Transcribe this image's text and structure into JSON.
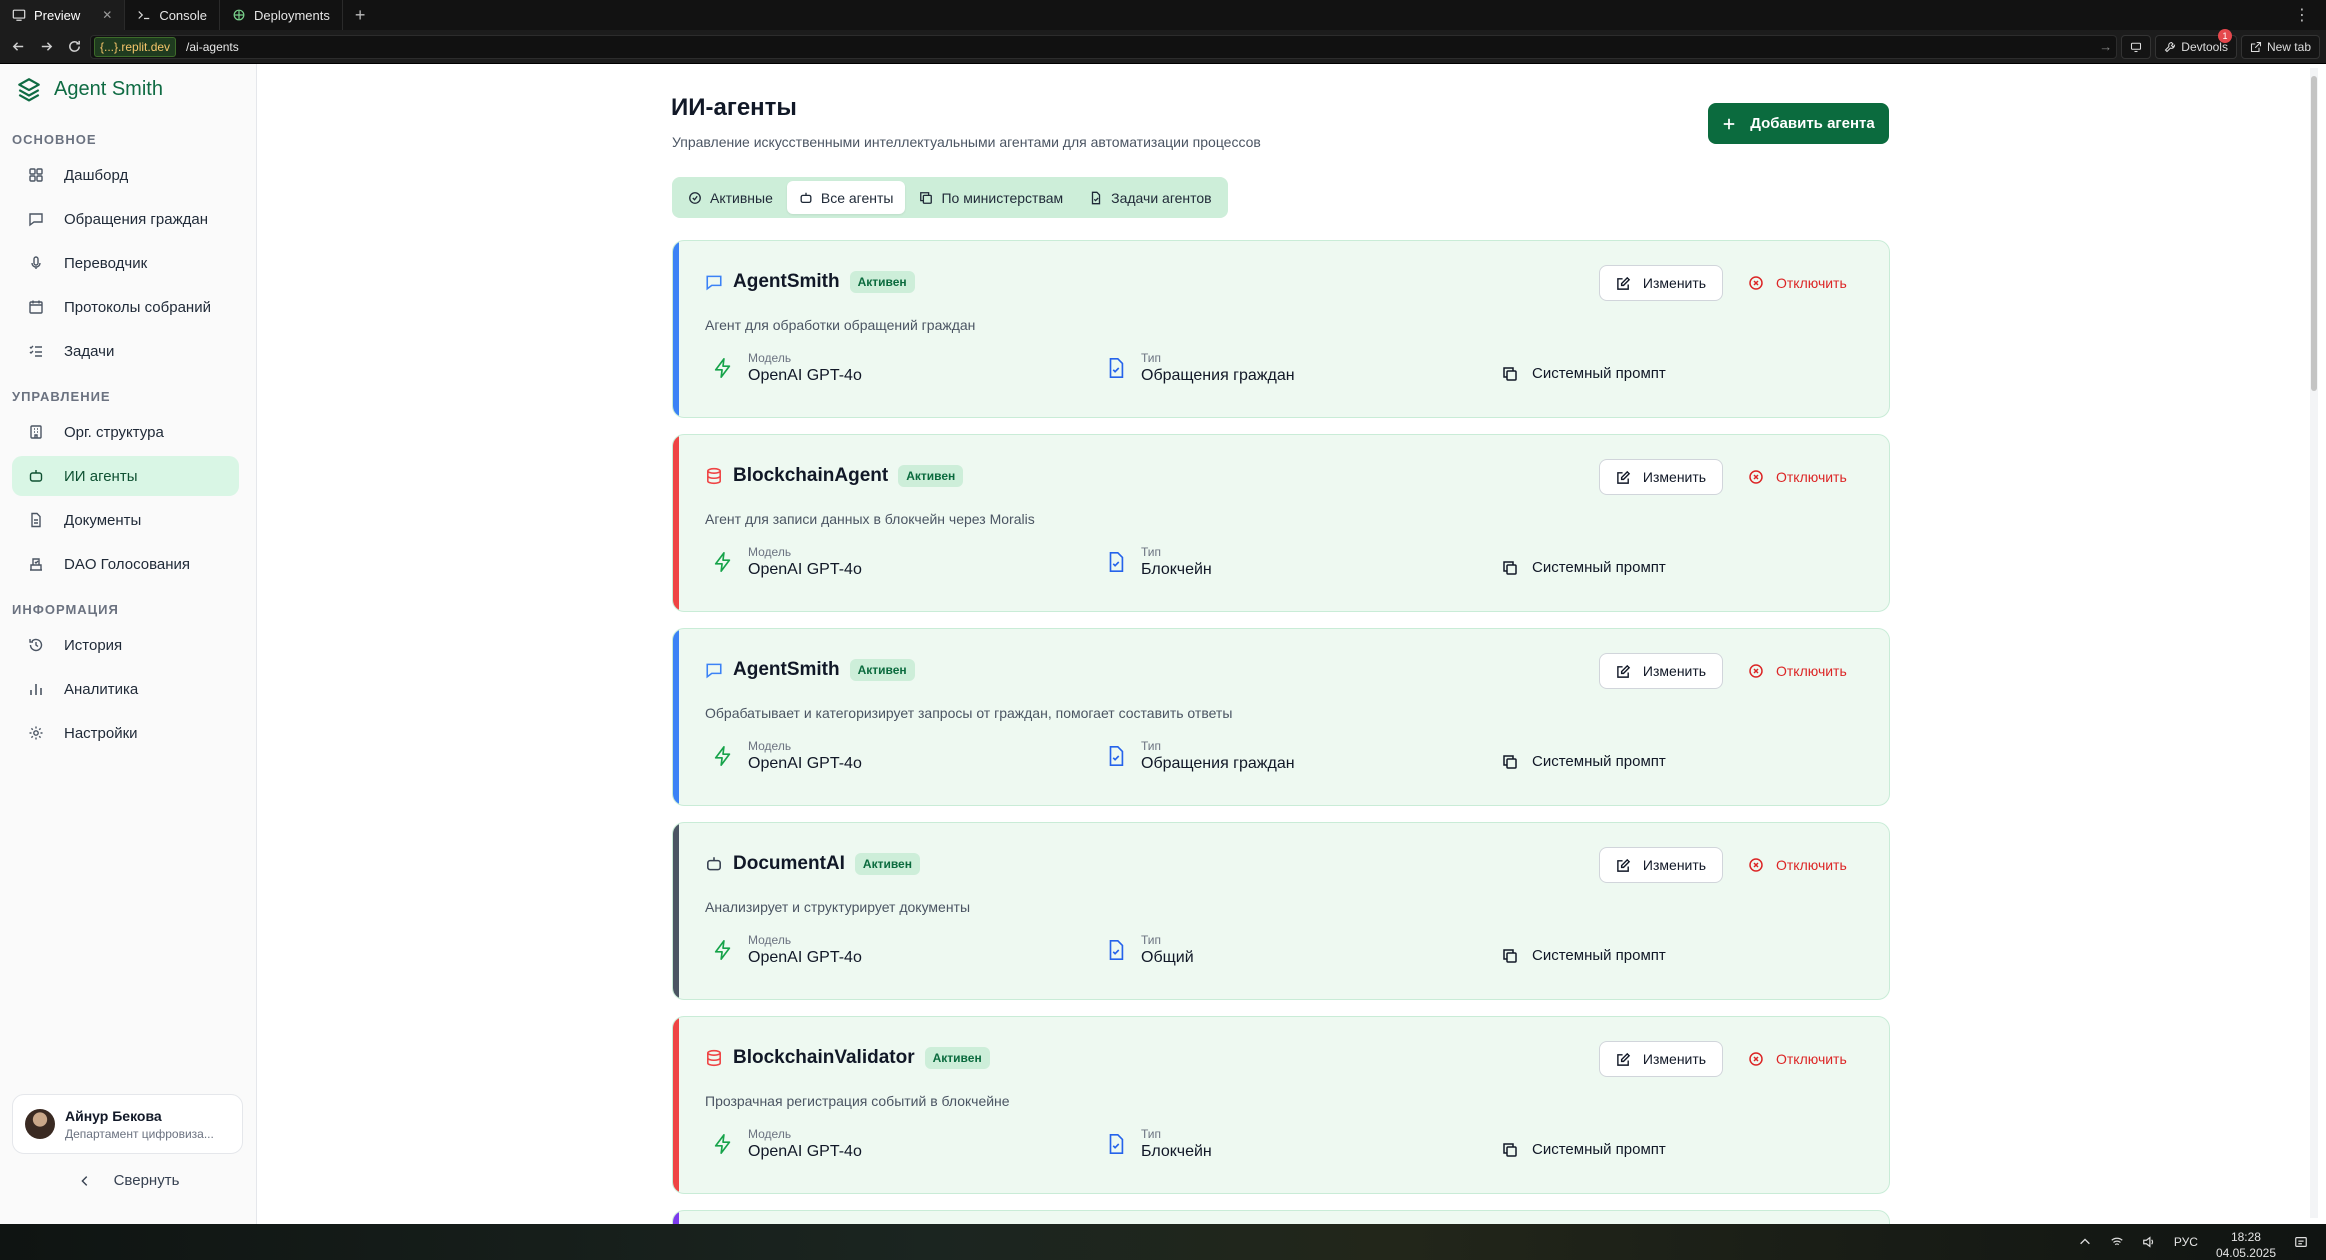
{
  "browser": {
    "tabs": [
      {
        "label": "Preview",
        "icon": "monitor-icon",
        "active": true
      },
      {
        "label": "Console",
        "icon": "terminal-icon"
      },
      {
        "label": "Deployments",
        "icon": "deploy-icon"
      }
    ],
    "url_domain": "{...}.replit.dev",
    "url_path": "/ai-agents",
    "devtools_label": "Devtools",
    "devtools_badge": "1",
    "newtab_label": "New tab"
  },
  "sidebar": {
    "brand": "Agent Smith",
    "sections": [
      {
        "title": "ОСНОВНОЕ",
        "items": [
          {
            "label": "Дашборд",
            "icon": "grid-icon"
          },
          {
            "label": "Обращения граждан",
            "icon": "message-icon"
          },
          {
            "label": "Переводчик",
            "icon": "mic-icon"
          },
          {
            "label": "Протоколы собраний",
            "icon": "calendar-icon"
          },
          {
            "label": "Задачи",
            "icon": "list-check-icon"
          }
        ]
      },
      {
        "title": "УПРАВЛЕНИЕ",
        "items": [
          {
            "label": "Орг. структура",
            "icon": "building-icon"
          },
          {
            "label": "ИИ агенты",
            "icon": "bot-icon",
            "active": true
          },
          {
            "label": "Документы",
            "icon": "document-icon"
          },
          {
            "label": "DAO Голосования",
            "icon": "vote-icon"
          }
        ]
      },
      {
        "title": "ИНФОРМАЦИЯ",
        "items": [
          {
            "label": "История",
            "icon": "history-icon"
          },
          {
            "label": "Аналитика",
            "icon": "bar-chart-icon"
          },
          {
            "label": "Настройки",
            "icon": "gear-icon"
          }
        ]
      }
    ],
    "user": {
      "name": "Айнур Бекова",
      "dept": "Департамент цифровиза..."
    },
    "collapse_label": "Свернуть"
  },
  "main": {
    "title": "ИИ-агенты",
    "subtitle": "Управление искусственными интеллектуальными агентами для автоматизации процессов",
    "add_button": "Добавить агента",
    "tabs": [
      {
        "label": "Активные",
        "icon": "check-circle-icon"
      },
      {
        "label": "Все агенты",
        "icon": "bot-icon",
        "active": true
      },
      {
        "label": "По министерствам",
        "icon": "copy-icon"
      },
      {
        "label": "Задачи агентов",
        "icon": "file-check-icon"
      }
    ],
    "model_label": "Модель",
    "type_label": "Тип",
    "prompt_label": "Системный промпт",
    "edit_label": "Изменить",
    "disable_label": "Отключить",
    "agents": [
      {
        "name": "AgentSmith",
        "status": "Активен",
        "description": "Агент для обработки обращений граждан",
        "model": "OpenAI GPT-4o",
        "type": "Обращения граждан",
        "accent": "#3b82f6",
        "icon": "chat-icon"
      },
      {
        "name": "BlockchainAgent",
        "status": "Активен",
        "description": "Агент для записи данных в блокчейн через Moralis",
        "model": "OpenAI GPT-4o",
        "type": "Блокчейн",
        "accent": "#ef4444",
        "icon": "database-icon"
      },
      {
        "name": "AgentSmith",
        "status": "Активен",
        "description": "Обрабатывает и категоризирует запросы от граждан, помогает составить ответы",
        "model": "OpenAI GPT-4o",
        "type": "Обращения граждан",
        "accent": "#3b82f6",
        "icon": "chat-icon"
      },
      {
        "name": "DocumentAI",
        "status": "Активен",
        "description": "Анализирует и структурирует документы",
        "model": "OpenAI GPT-4o",
        "type": "Общий",
        "accent": "#4b5563",
        "icon": "bot-icon"
      },
      {
        "name": "BlockchainValidator",
        "status": "Активен",
        "description": "Прозрачная регистрация событий в блокчейне",
        "model": "OpenAI GPT-4o",
        "type": "Блокчейн",
        "accent": "#ef4444",
        "icon": "database-icon"
      }
    ]
  },
  "taskbar": {
    "lang": "РУС",
    "time": "18:28",
    "date": "04.05.2025"
  }
}
